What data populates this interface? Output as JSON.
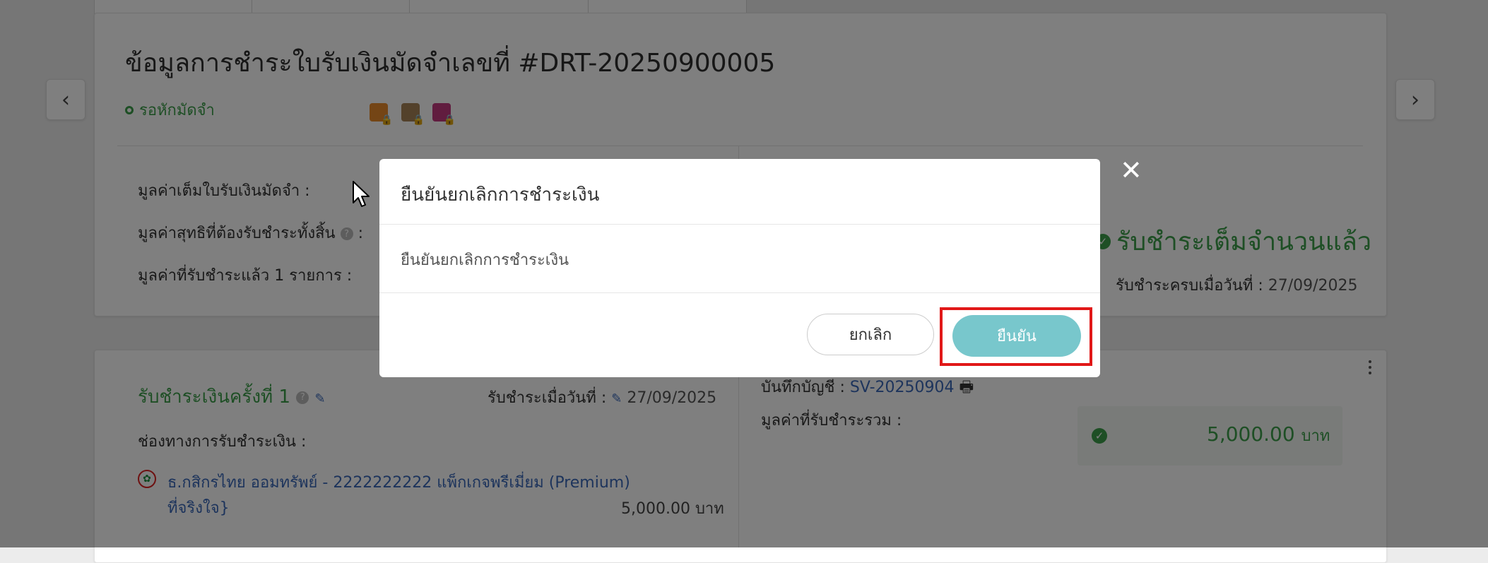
{
  "colors": {
    "accent": "#78c7cc",
    "success": "#3c9e4a",
    "link": "#3a68b8",
    "highlight": "#e11818"
  },
  "header": {
    "title": "ข้อมูลการชำระใบรับเงินมัดจำเลขที่ #DRT-20250900005",
    "status": "รอหักมัดจำ",
    "status_icons": [
      "orange-lock-icon",
      "brown-lock-icon",
      "pink-lock-icon"
    ]
  },
  "summary": {
    "full_value_label": "มูลค่าเต็มใบรับเงินมัดจำ :",
    "net_value_label": "มูลค่าสุทธิที่ต้องรับชำระทั้งสิ้น",
    "paid_value_label": "มูลค่าที่รับชำระแล้ว 1 รายการ :",
    "paid_status": "รับชำระเต็มจำนวนแล้ว",
    "paid_date_label": "รับชำระครบเมื่อวันที่ :",
    "paid_date": "27/09/2025"
  },
  "payment": {
    "heading": "รับชำระเงินครั้งที่ 1",
    "date_label": "รับชำระเมื่อวันที่ :",
    "date": "27/09/2025",
    "channel_label": "ช่องทางการรับชำระเงิน :",
    "bank_line1": "ธ.กสิกรไทย ออมทรัพย์ - 2222222222 แพ็กเกจพรีเมี่ยม (Premium)",
    "bank_line2": "ที่จริงใจ}",
    "bank_amount": "5,000.00 บาท",
    "journal_label": "บันทึกบัญชี :",
    "journal_no": "SV-20250904",
    "total_label": "มูลค่าที่รับชำระรวม :",
    "total_amount": "5,000.00",
    "total_unit": "บาท"
  },
  "modal": {
    "title": "ยืนยันยกเลิกการชำระเงิน",
    "body": "ยืนยันยกเลิกการชำระเงิน",
    "cancel_label": "ยกเลิก",
    "confirm_label": "ยืนยัน"
  }
}
